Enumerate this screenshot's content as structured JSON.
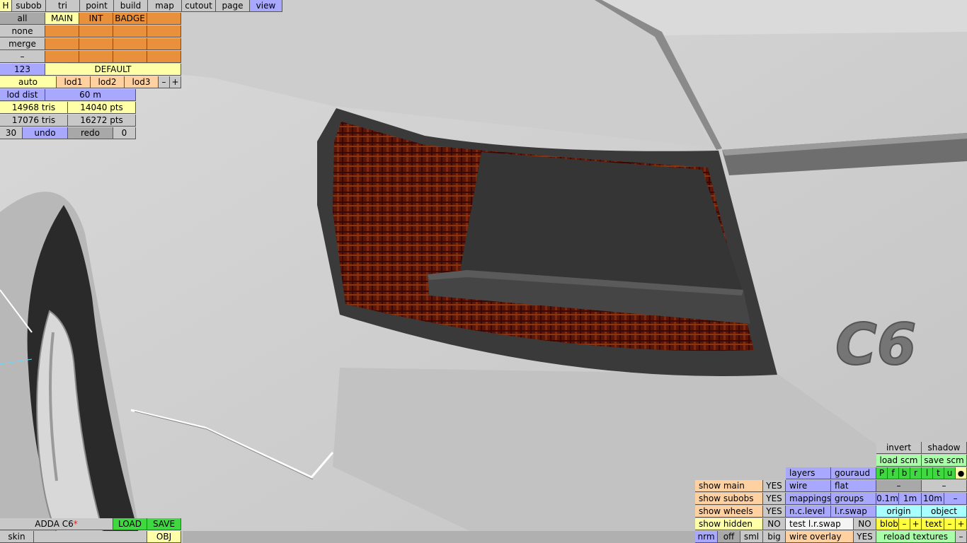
{
  "topbar": [
    "H",
    "subob",
    "tri",
    "point",
    "build",
    "map",
    "cutout",
    "page",
    "view"
  ],
  "layers": {
    "header": [
      "all",
      "MAIN",
      "INT",
      "BADGE"
    ],
    "rows": [
      "none",
      "merge",
      "–"
    ],
    "count": "123",
    "default": "DEFAULT"
  },
  "lod": {
    "auto": "auto",
    "lod1": "lod1",
    "lod2": "lod2",
    "lod3": "lod3",
    "minus": "–",
    "plus": "+",
    "dist_label": "lod dist",
    "dist_value": "60 m"
  },
  "stats": {
    "tris1": "14968 tris",
    "pts1": "14040 pts",
    "tris2": "17076 tris",
    "pts2": "16272 pts"
  },
  "history": {
    "count": "30",
    "undo": "undo",
    "redo": "redo",
    "redo_count": "0"
  },
  "file": {
    "name": "ADDA C6",
    "modified_mark": "*",
    "load": "LOAD",
    "save": "SAVE",
    "skin": "skin",
    "obj": "OBJ"
  },
  "scene": {
    "badge_text": "C6"
  },
  "right_panel": {
    "invert": "invert",
    "shadow": "shadow",
    "load_scm": "load scm",
    "save_scm": "save scm",
    "layers": "layers",
    "gouraud": "gouraud",
    "view_letters": [
      "P",
      "f",
      "b",
      "r",
      "l",
      "t",
      "u"
    ],
    "view_dot": "●",
    "wire": "wire",
    "flat": "flat",
    "dash": "–",
    "mappings": "mappings",
    "groups": "groups",
    "grid": [
      "0.1m",
      "1m",
      "10m"
    ],
    "nclevel": "n.c.level",
    "lrswap": "l.r.swap",
    "origin": "origin",
    "object": "object",
    "test_lrswap": "test l.r.swap",
    "blob": "blob",
    "text": "text",
    "plus": "+",
    "wire_overlay": "wire overlay",
    "reload_textures": "reload textures"
  },
  "show": [
    {
      "label": "show main",
      "value": "YES"
    },
    {
      "label": "show subobs",
      "value": "YES"
    },
    {
      "label": "show wheels",
      "value": "YES"
    },
    {
      "label": "show hidden",
      "value": "NO"
    }
  ],
  "test_lrswap_value": "NO",
  "wire_overlay_value": "YES",
  "render_modes": [
    "nrm",
    "off",
    "sml",
    "big"
  ]
}
